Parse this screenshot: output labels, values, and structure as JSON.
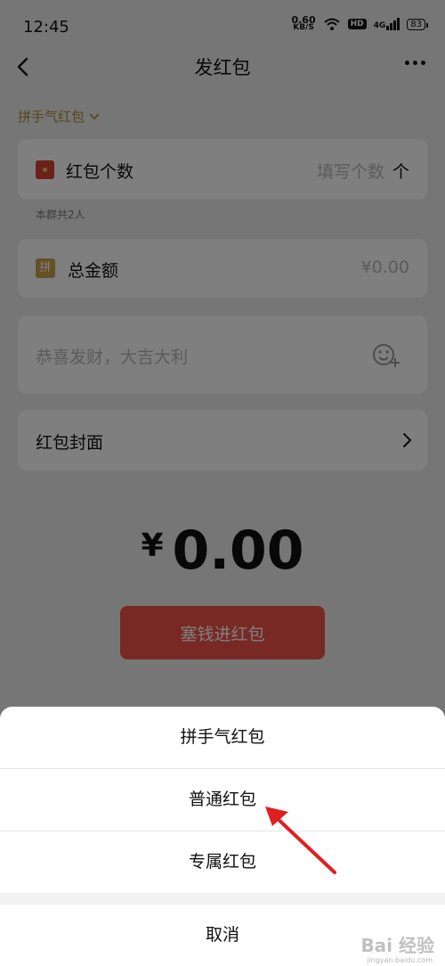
{
  "status_bar": {
    "time": "12:45",
    "net_speed": "0.60",
    "net_speed_unit": "KB/S",
    "hd_label": "HD",
    "signal_label": "4G",
    "battery": "83"
  },
  "nav": {
    "title": "发红包",
    "back_icon": "chevron-left-icon",
    "more_icon": "more-dots-icon"
  },
  "packet_type": {
    "label": "拼手气红包",
    "icon": "chevron-down-icon"
  },
  "count_field": {
    "label": "红包个数",
    "placeholder": "填写个数",
    "unit": "个"
  },
  "group_note": "本群共2人",
  "total_field": {
    "icon_text": "拼",
    "label": "总金额",
    "value": "¥0.00"
  },
  "blessing_field": {
    "placeholder": "恭喜发财，大吉大利",
    "icon": "emoji-add-icon"
  },
  "cover_row": {
    "label": "红包封面",
    "icon": "chevron-right-icon"
  },
  "amount": {
    "symbol": "¥",
    "value": "0.00"
  },
  "submit_label": "塞钱进红包",
  "sheet": {
    "options": [
      {
        "label": "拼手气红包"
      },
      {
        "label": "普通红包"
      },
      {
        "label": "专属红包"
      }
    ],
    "cancel_label": "取消"
  },
  "annotation": {
    "type": "arrow",
    "color": "#e02020"
  },
  "watermark": {
    "main": "Bai 经验",
    "sub": "jingyan.baidu.com"
  },
  "colors": {
    "accent_red": "#f0534a",
    "gold": "#b08d3a",
    "envelope_red": "#d9433a"
  }
}
